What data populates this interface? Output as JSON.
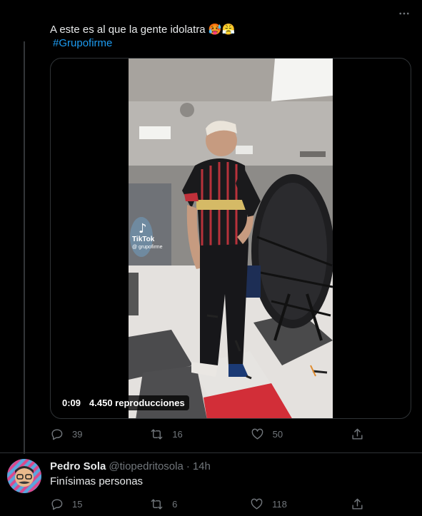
{
  "tweet": {
    "text": "A este es al que la gente idolatra",
    "emojis": [
      "🥵",
      "😤"
    ],
    "hashtag": "#Grupofirme",
    "video": {
      "watermark_brand": "TikTok",
      "watermark_handle": "@ grupofirme",
      "duration": "0:09",
      "views": "4.450 reproducciones"
    },
    "actions": {
      "reply_count": "39",
      "retweet_count": "16",
      "like_count": "50"
    }
  },
  "reply": {
    "name": "Pedro Sola",
    "handle": "@tiopedritosola",
    "separator": "·",
    "time": "14h",
    "text": "Finísimas personas",
    "actions": {
      "reply_count": "15",
      "retweet_count": "6",
      "like_count": "118"
    }
  },
  "icons": {
    "more": "more-horizontal-icon",
    "reply": "reply-icon",
    "retweet": "retweet-icon",
    "like": "heart-icon",
    "share": "share-icon",
    "tiktok": "tiktok-logo-icon"
  },
  "colors": {
    "background": "#000000",
    "text": "#e7e9ea",
    "muted": "#71767b",
    "link": "#1d9bf0",
    "border": "#2f3336"
  }
}
